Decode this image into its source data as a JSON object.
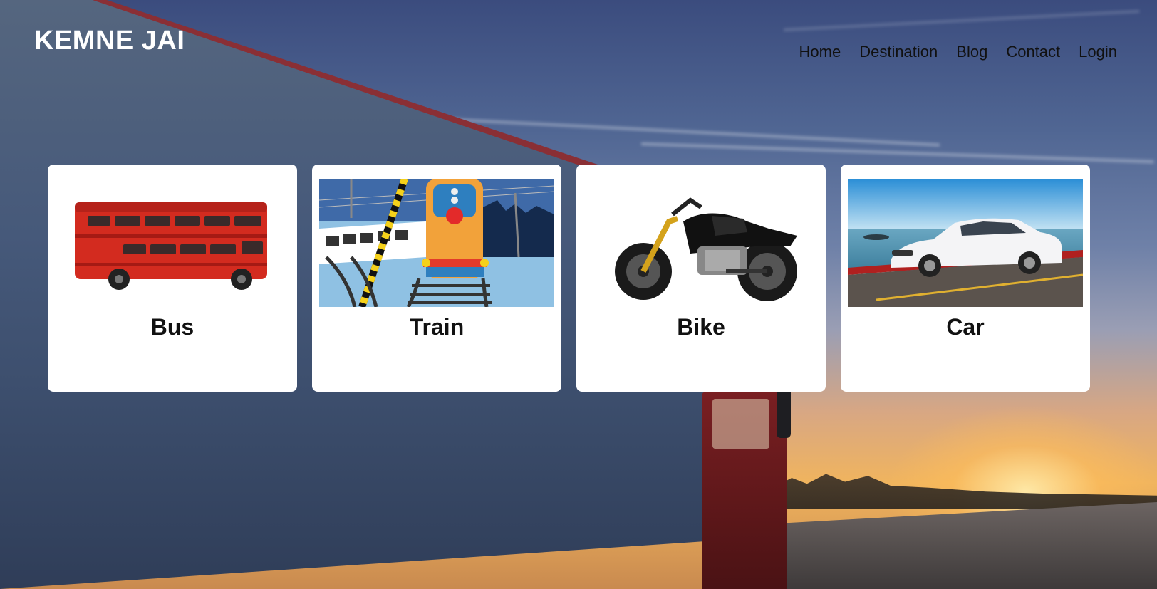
{
  "brand": {
    "name": "KEMNE JAI"
  },
  "nav": {
    "items": [
      {
        "label": "Home"
      },
      {
        "label": "Destination"
      },
      {
        "label": "Blog"
      },
      {
        "label": "Contact"
      },
      {
        "label": "Login"
      }
    ]
  },
  "cards": [
    {
      "title": "Bus",
      "icon": "double-decker-bus-image"
    },
    {
      "title": "Train",
      "icon": "locomotive-image"
    },
    {
      "title": "Bike",
      "icon": "motorcycle-image"
    },
    {
      "title": "Car",
      "icon": "white-sedan-image"
    }
  ],
  "colors": {
    "bus_red": "#d32b1f",
    "card_bg": "#ffffff",
    "logo_text": "#ffffff",
    "nav_text": "#111111"
  }
}
